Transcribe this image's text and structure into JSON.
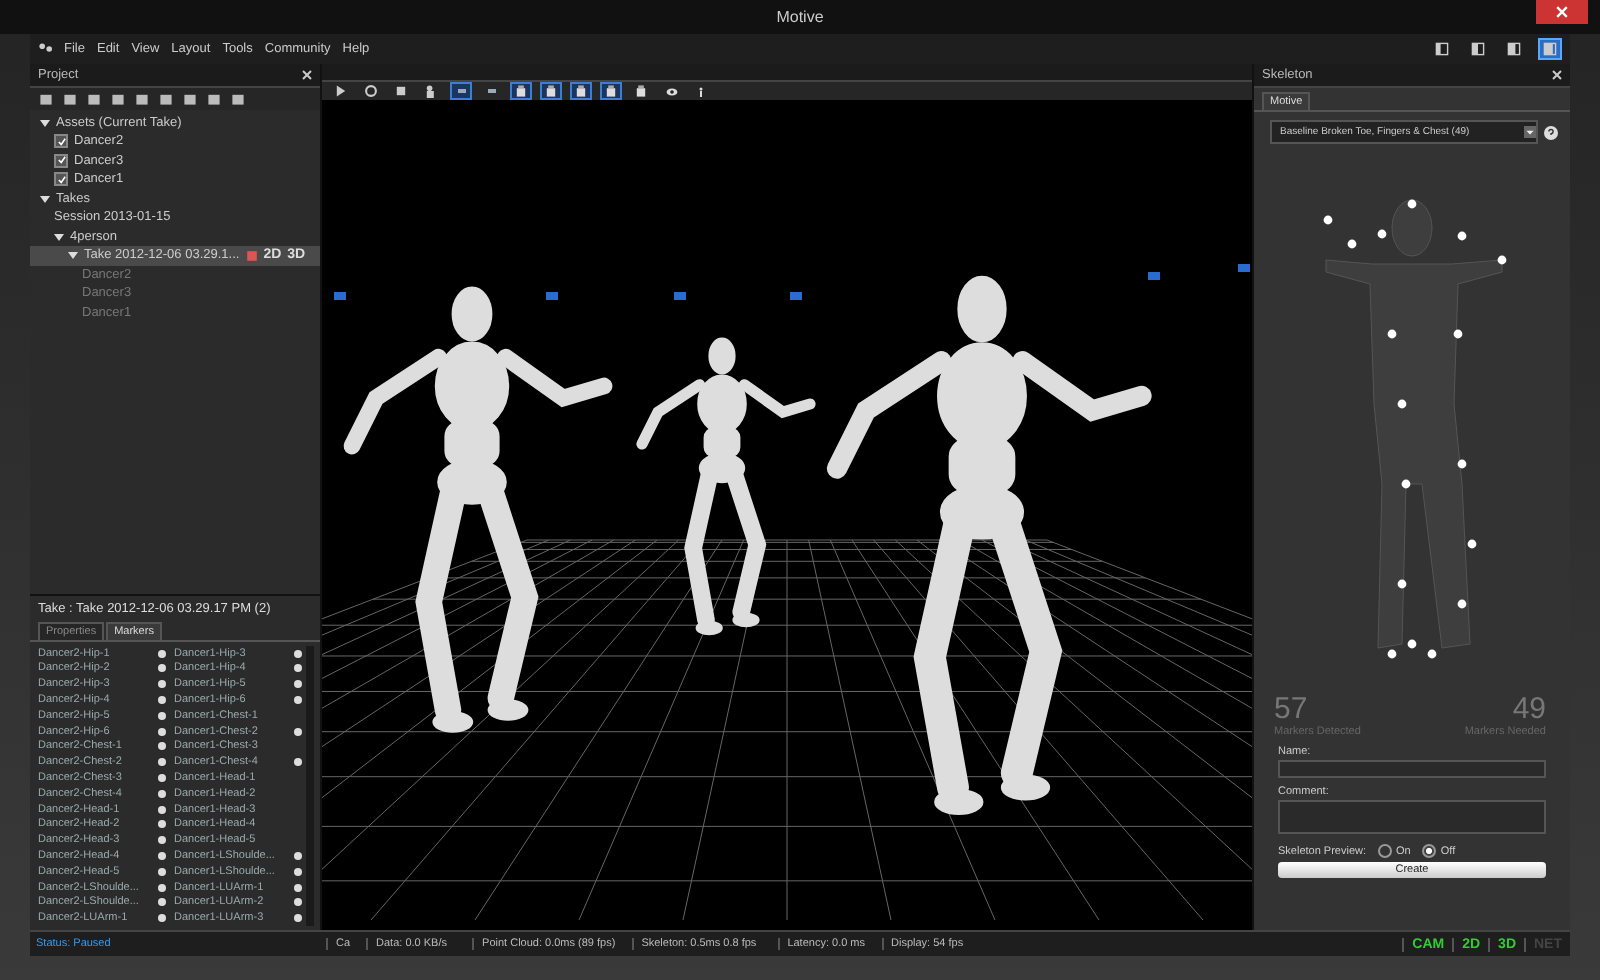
{
  "window": {
    "title": "Motive"
  },
  "menu": [
    "File",
    "Edit",
    "View",
    "Layout",
    "Tools",
    "Community",
    "Help"
  ],
  "layout_buttons": [
    {
      "selected": false
    },
    {
      "selected": false
    },
    {
      "selected": false
    },
    {
      "selected": true
    }
  ],
  "project": {
    "title": "Project",
    "tree": [
      {
        "label": "Assets (Current Take)",
        "expanded": true,
        "children": [
          {
            "label": "Dancer2",
            "checked": true
          },
          {
            "label": "Dancer3",
            "checked": true
          },
          {
            "label": "Dancer1",
            "checked": true
          }
        ]
      },
      {
        "label": "Takes",
        "expanded": true,
        "children": [
          {
            "label": "Session 2013-01-15"
          },
          {
            "label": "4person",
            "expanded": true,
            "children": [
              {
                "label": "Take 2012-12-06 03.29.1...",
                "expanded": true,
                "selected": true,
                "badges": [
                  "2D",
                  "3D"
                ],
                "children": [
                  {
                    "label": "Dancer2",
                    "disabled": true
                  },
                  {
                    "label": "Dancer3",
                    "disabled": true
                  },
                  {
                    "label": "Dancer1",
                    "disabled": true
                  }
                ]
              }
            ]
          }
        ]
      }
    ]
  },
  "take_panel": {
    "title": "Take : Take 2012-12-06 03.29.17 PM (2)",
    "tabs": [
      {
        "label": "Properties",
        "selected": false
      },
      {
        "label": "Markers",
        "selected": true
      }
    ],
    "columns": [
      [
        {
          "name": "Dancer2-Hip-1",
          "tracked": true
        },
        {
          "name": "Dancer2-Hip-2",
          "tracked": true
        },
        {
          "name": "Dancer2-Hip-3",
          "tracked": true
        },
        {
          "name": "Dancer2-Hip-4",
          "tracked": true
        },
        {
          "name": "Dancer2-Hip-5",
          "tracked": true
        },
        {
          "name": "Dancer2-Hip-6",
          "tracked": true
        },
        {
          "name": "Dancer2-Chest-1",
          "tracked": true
        },
        {
          "name": "Dancer2-Chest-2",
          "tracked": true
        },
        {
          "name": "Dancer2-Chest-3",
          "tracked": true
        },
        {
          "name": "Dancer2-Chest-4",
          "tracked": true
        },
        {
          "name": "Dancer2-Head-1",
          "tracked": true
        },
        {
          "name": "Dancer2-Head-2",
          "tracked": true
        },
        {
          "name": "Dancer2-Head-3",
          "tracked": true
        },
        {
          "name": "Dancer2-Head-4",
          "tracked": true
        },
        {
          "name": "Dancer2-Head-5",
          "tracked": true
        },
        {
          "name": "Dancer2-LShoulde...",
          "tracked": true
        },
        {
          "name": "Dancer2-LShoulde...",
          "tracked": true
        },
        {
          "name": "Dancer2-LUArm-1",
          "tracked": true
        }
      ],
      [
        {
          "name": "Dancer1-Hip-3",
          "tracked": true
        },
        {
          "name": "Dancer1-Hip-4",
          "tracked": true
        },
        {
          "name": "Dancer1-Hip-5",
          "tracked": true
        },
        {
          "name": "Dancer1-Hip-6",
          "tracked": true
        },
        {
          "name": "Dancer1-Chest-1",
          "tracked": false
        },
        {
          "name": "Dancer1-Chest-2",
          "tracked": true
        },
        {
          "name": "Dancer1-Chest-3",
          "tracked": false
        },
        {
          "name": "Dancer1-Chest-4",
          "tracked": true
        },
        {
          "name": "Dancer1-Head-1",
          "tracked": false
        },
        {
          "name": "Dancer1-Head-2",
          "tracked": false
        },
        {
          "name": "Dancer1-Head-3",
          "tracked": false
        },
        {
          "name": "Dancer1-Head-4",
          "tracked": false
        },
        {
          "name": "Dancer1-Head-5",
          "tracked": false
        },
        {
          "name": "Dancer1-LShoulde...",
          "tracked": true
        },
        {
          "name": "Dancer1-LShoulde...",
          "tracked": true
        },
        {
          "name": "Dancer1-LUArm-1",
          "tracked": true
        },
        {
          "name": "Dancer1-LUArm-2",
          "tracked": true
        },
        {
          "name": "Dancer1-LUArm-3",
          "tracked": true
        }
      ]
    ]
  },
  "viewport_tools": [
    {
      "kind": "cursor",
      "selected": false
    },
    {
      "kind": "rotate",
      "selected": false
    },
    {
      "kind": "square",
      "selected": false
    },
    {
      "kind": "figures",
      "selected": false
    },
    {
      "kind": "label",
      "selected": true
    },
    {
      "kind": "label",
      "selected": false
    },
    {
      "kind": "cube",
      "selected": true
    },
    {
      "kind": "cube",
      "selected": true
    },
    {
      "kind": "cube",
      "selected": true
    },
    {
      "kind": "cube",
      "selected": true
    },
    {
      "kind": "cube",
      "selected": false
    },
    {
      "kind": "eye",
      "selected": false
    },
    {
      "kind": "info",
      "selected": false
    }
  ],
  "skeleton": {
    "title": "Skeleton",
    "tabs": [
      {
        "label": "Motive",
        "selected": true
      }
    ],
    "template": "Baseline Broken Toe, Fingers & Chest (49)",
    "detected": {
      "value": "57",
      "label": "Markers Detected"
    },
    "needed": {
      "value": "49",
      "label": "Markers Needed"
    },
    "name_label": "Name:",
    "comment_label": "Comment:",
    "preview_label": "Skeleton Preview:",
    "preview_options": [
      {
        "label": "On",
        "selected": false
      },
      {
        "label": "Off",
        "selected": true
      }
    ],
    "button": "Create"
  },
  "status_bar": {
    "status": "Status: Paused",
    "fields": [
      "Ca",
      "Data: 0.0 KB/s",
      "Point Cloud: 0.0ms (89 fps)",
      "Skeleton: 0.5ms 0.8 fps",
      "Latency: 0.0 ms",
      "Display: 54 fps"
    ],
    "indicators": [
      {
        "label": "CAM",
        "on": true
      },
      {
        "label": "2D",
        "on": true
      },
      {
        "label": "3D",
        "on": true
      },
      {
        "label": "NET",
        "on": false
      }
    ]
  }
}
